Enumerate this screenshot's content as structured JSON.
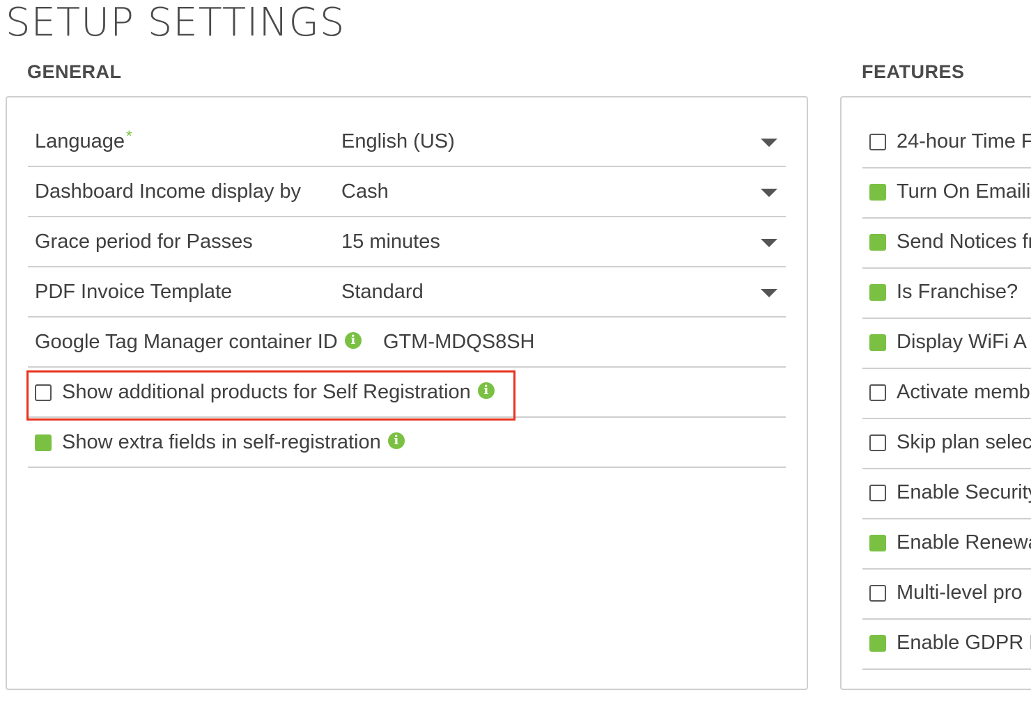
{
  "page": {
    "title": "SETUP SETTINGS"
  },
  "general": {
    "title": "GENERAL",
    "rows": [
      {
        "label": "Language",
        "required": "*",
        "value": "English (US)"
      },
      {
        "label": "Dashboard Income display by",
        "value": "Cash"
      },
      {
        "label": "Grace period for Passes",
        "value": "15 minutes"
      },
      {
        "label": "PDF Invoice Template",
        "value": "Standard"
      },
      {
        "label": "Google Tag Manager container ID",
        "value": "GTM-MDQS8SH"
      }
    ],
    "checkboxes": [
      {
        "label": "Show additional products for Self Registration",
        "checked": false
      },
      {
        "label": "Show extra fields in self-registration",
        "checked": true
      }
    ],
    "info_glyph": "i"
  },
  "features": {
    "title": "FEATURES",
    "items": [
      {
        "label": "24-hour Time F",
        "checked": false
      },
      {
        "label": "Turn On Emaili",
        "checked": true
      },
      {
        "label": "Send Notices fr",
        "checked": true
      },
      {
        "label": "Is Franchise?",
        "checked": true
      },
      {
        "label": "Display WiFi A",
        "checked": true
      },
      {
        "label": "Activate memb",
        "checked": false
      },
      {
        "label": "Skip plan selec",
        "checked": false
      },
      {
        "label": "Enable Security",
        "checked": false
      },
      {
        "label": "Enable Renewa",
        "checked": true
      },
      {
        "label": "Multi-level pro",
        "checked": false
      },
      {
        "label": "Enable GDPR D",
        "checked": true
      }
    ]
  },
  "colors": {
    "accent_green": "#7ac143",
    "highlight_red": "#e8321e",
    "border_gray": "#cfcfcf"
  }
}
